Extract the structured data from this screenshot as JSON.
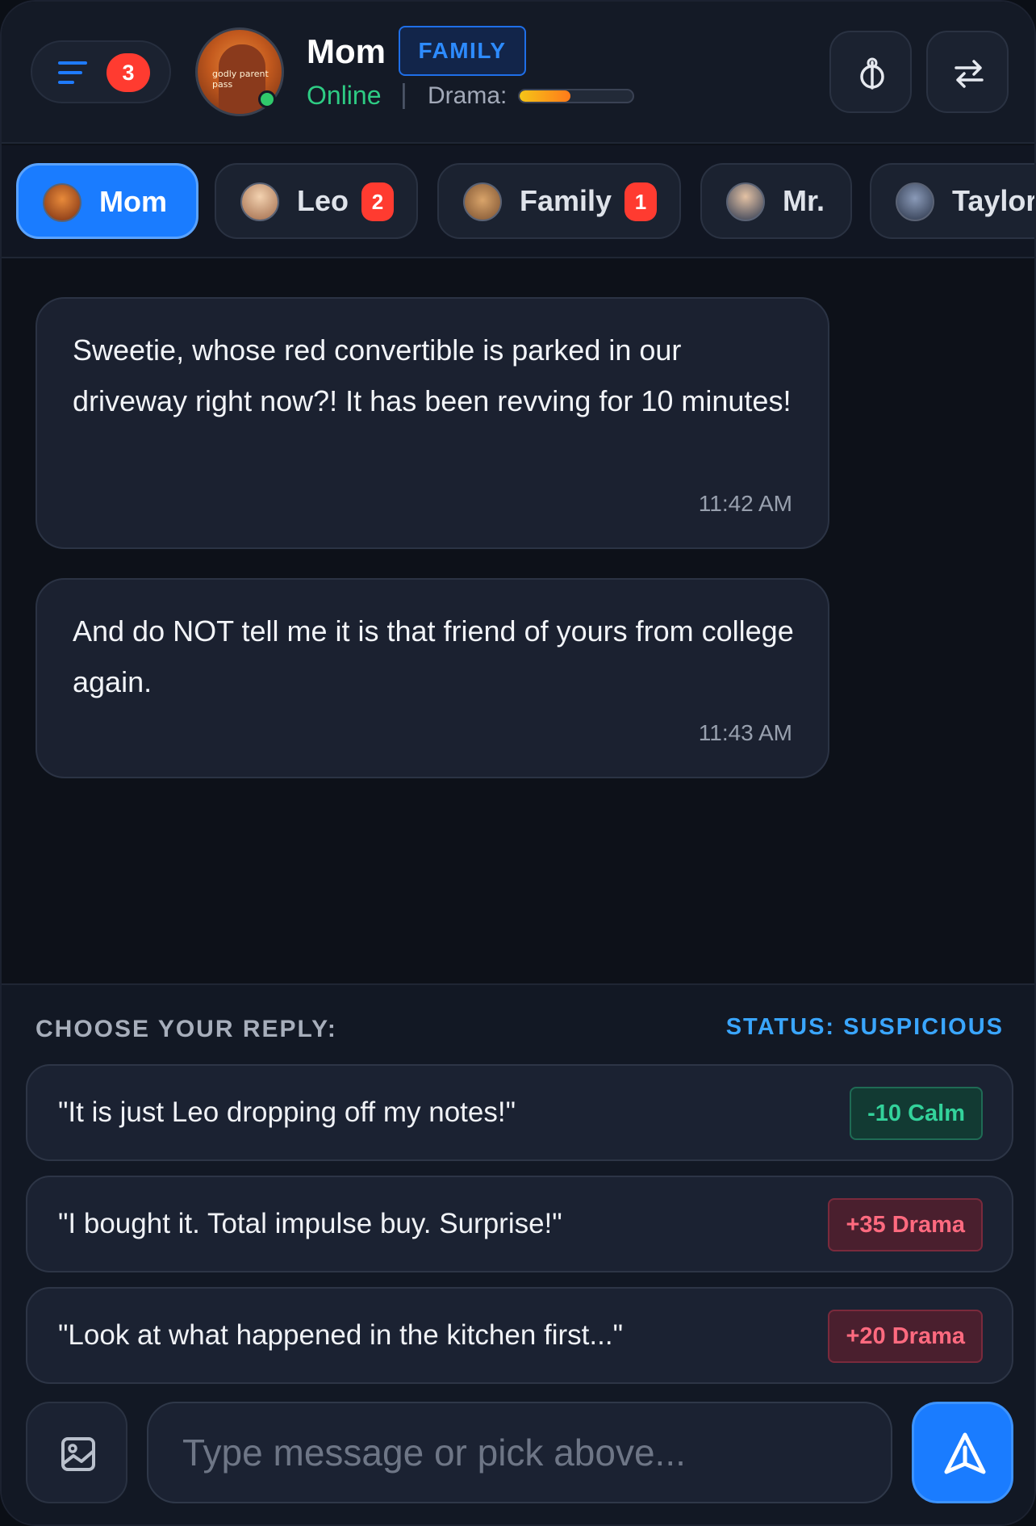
{
  "header": {
    "menu_badge": "3",
    "contact_name": "Mom",
    "relation_tag": "FAMILY",
    "status": "Online",
    "separator": "|",
    "drama_label": "Drama:",
    "drama_level": 0.45,
    "avatar_caption": "godly parent pass",
    "icons": [
      "menu-icon",
      "ring-icon",
      "swap-icon"
    ]
  },
  "tabs": [
    {
      "label": "Mom",
      "badge": null,
      "active": true
    },
    {
      "label": "Leo",
      "badge": "2",
      "active": false
    },
    {
      "label": "Family",
      "badge": "1",
      "active": false
    },
    {
      "label": "Mr.",
      "badge": null,
      "active": false
    },
    {
      "label": "Taylor",
      "badge": null,
      "active": false
    }
  ],
  "messages": [
    {
      "text": "Sweetie, whose red convertible is parked in our driveway right now?! It has been revving for 10 minutes!",
      "time": "11:42 AM"
    },
    {
      "text": "And do NOT tell me it is that friend of yours from college again.",
      "time": "11:43 AM"
    }
  ],
  "replies": {
    "choose_label": "CHOOSE YOUR REPLY:",
    "status_label": "STATUS: SUSPICIOUS",
    "options": [
      {
        "text": "\"It is just Leo dropping off my notes!\"",
        "effect": "-10 Calm",
        "kind": "calm"
      },
      {
        "text": "\"I bought it. Total impulse buy. Surprise!\"",
        "effect": "+35 Drama",
        "kind": "drama"
      },
      {
        "text": "\"Look at what happened in the kitchen first...\"",
        "effect": "+20 Drama",
        "kind": "drama"
      }
    ]
  },
  "composer": {
    "placeholder": "Type message or pick above...",
    "icons": [
      "image-icon",
      "send-icon"
    ]
  },
  "colors": {
    "accent": "#1a7cff",
    "online": "#2ecc84",
    "badge": "#ff3b30",
    "calm": "#33d29b",
    "drama": "#ff6a7f",
    "status": "#3aa6ff"
  }
}
